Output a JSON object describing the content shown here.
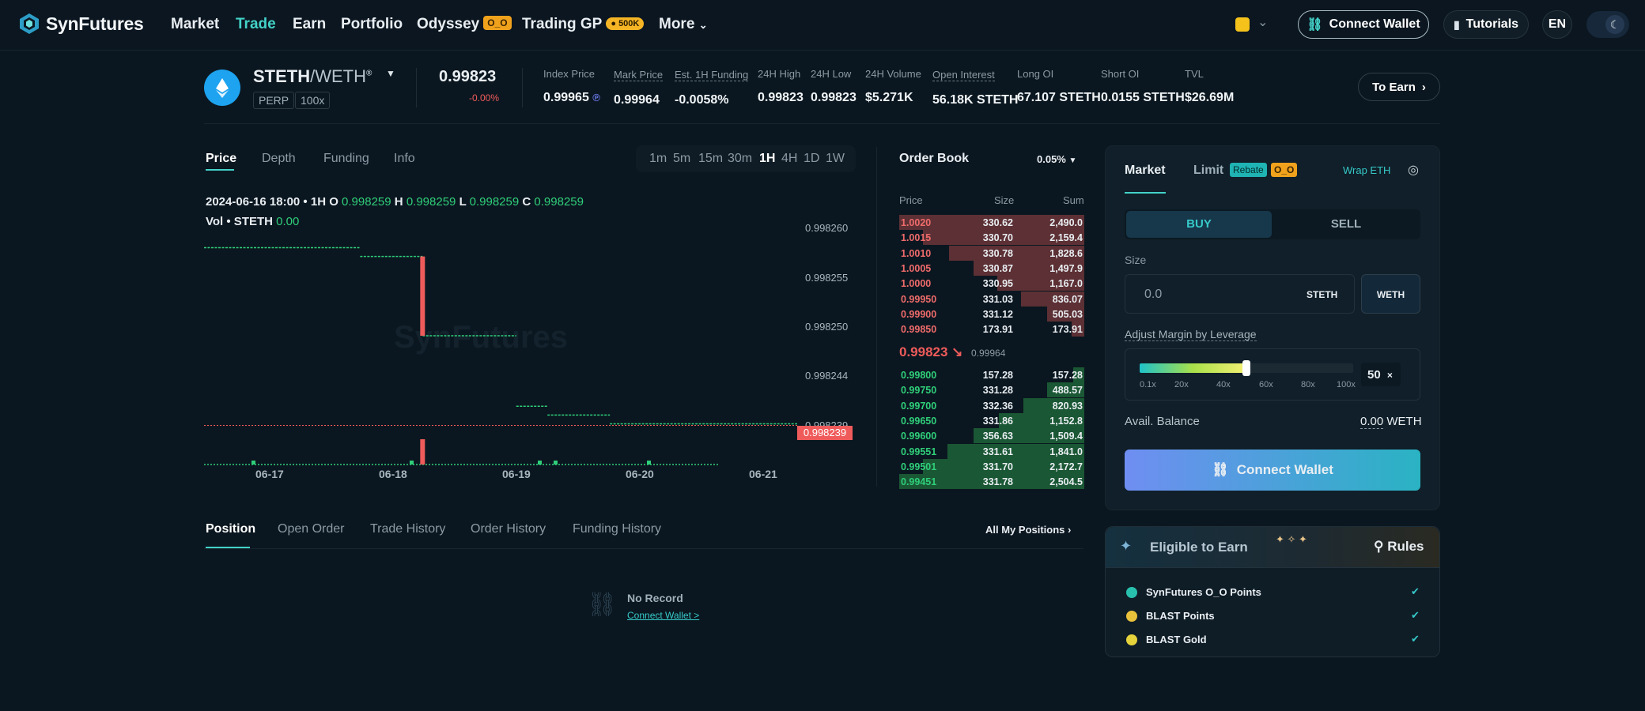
{
  "nav": {
    "brand": "SynFutures",
    "items": [
      "Market",
      "Trade",
      "Earn",
      "Portfolio",
      "Odyssey",
      "Trading GP",
      "More"
    ],
    "odyssey_badge": "O_O",
    "gp_badge": "500K",
    "connect_wallet": "Connect Wallet",
    "tutorials": "Tutorials",
    "lang": "EN"
  },
  "market": {
    "base": "STETH",
    "quote": "/WETH",
    "type_tag": "PERP",
    "leverage_tag": "100x",
    "price": "0.99823",
    "change": "-0.00%",
    "stats": [
      {
        "label": "Index Price",
        "value": "0.99965"
      },
      {
        "label": "Mark Price",
        "value": "0.99964"
      },
      {
        "label": "Est. 1H Funding",
        "value": "-0.0058%"
      },
      {
        "label": "24H High",
        "value": "0.99823"
      },
      {
        "label": "24H Low",
        "value": "0.99823"
      },
      {
        "label": "24H Volume",
        "value": "$5.271K"
      },
      {
        "label": "Open Interest",
        "value": "56.18K STETH"
      },
      {
        "label": "Long OI",
        "value": "67.107 STETH"
      },
      {
        "label": "Short OI",
        "value": "0.0155 STETH"
      },
      {
        "label": "TVL",
        "value": "$26.69M"
      }
    ],
    "to_earn": "To Earn"
  },
  "chart": {
    "tabs": [
      "Price",
      "Depth",
      "Funding",
      "Info"
    ],
    "timeframes": [
      "1m",
      "5m",
      "15m",
      "30m",
      "1H",
      "4H",
      "1D",
      "1W"
    ],
    "active_timeframe": "1H",
    "ohlc_date": "2024-06-16 18:00 • 1H",
    "o_label": "O",
    "o": "0.998259",
    "h_label": "H",
    "h": "0.998259",
    "l_label": "L",
    "l": "0.998259",
    "c_label": "C",
    "c": "0.998259",
    "vol_label": "Vol • STETH",
    "vol": "0.00",
    "price_tag": "0.998239"
  },
  "chart_data": {
    "type": "candlestick",
    "title": "",
    "xlabel": "",
    "ylabel": "",
    "x_ticks": [
      "06-17",
      "06-18",
      "06-19",
      "06-20",
      "06-21"
    ],
    "y_ticks": [
      "0.998260",
      "0.998255",
      "0.998250",
      "0.998244",
      "0.998239"
    ],
    "ylim": [
      0.998236,
      0.998262
    ],
    "last_price": 0.998239,
    "segments": [
      {
        "from": "06-16 18:00",
        "to": "06-18 00:00",
        "value": 0.998259
      },
      {
        "from": "06-18 00:00",
        "to": "06-18 12:00",
        "value": 0.998258
      },
      {
        "from": "06-18 12:00",
        "to": "06-19 06:00",
        "value": 0.998249
      },
      {
        "from": "06-19 06:00",
        "to": "06-19 12:00",
        "value": 0.998241
      },
      {
        "from": "06-19 12:00",
        "to": "06-20 00:00",
        "value": 0.99824
      },
      {
        "from": "06-20 00:00",
        "to": "06-21 12:00",
        "value": 0.998239
      }
    ],
    "big_drop": {
      "time": "06-18 12:00",
      "open": 0.998258,
      "close": 0.998249
    }
  },
  "orderbook": {
    "title": "Order Book",
    "precision": "0.05%",
    "headers": [
      "Price",
      "Size",
      "Sum"
    ],
    "asks": [
      {
        "price": "1.0020",
        "size": "330.62",
        "sum": "2,490.0",
        "depth": 1.0
      },
      {
        "price": "1.0015",
        "size": "330.70",
        "sum": "2,159.4",
        "depth": 0.87
      },
      {
        "price": "1.0010",
        "size": "330.78",
        "sum": "1,828.6",
        "depth": 0.73
      },
      {
        "price": "1.0005",
        "size": "330.87",
        "sum": "1,497.9",
        "depth": 0.6
      },
      {
        "price": "1.0000",
        "size": "330.95",
        "sum": "1,167.0",
        "depth": 0.47
      },
      {
        "price": "0.99950",
        "size": "331.03",
        "sum": "836.07",
        "depth": 0.34
      },
      {
        "price": "0.99900",
        "size": "331.12",
        "sum": "505.03",
        "depth": 0.2
      },
      {
        "price": "0.99850",
        "size": "173.91",
        "sum": "173.91",
        "depth": 0.07
      }
    ],
    "last": "0.99823",
    "mark": "0.99964",
    "bids": [
      {
        "price": "0.99800",
        "size": "157.28",
        "sum": "157.28",
        "depth": 0.06
      },
      {
        "price": "0.99750",
        "size": "331.28",
        "sum": "488.57",
        "depth": 0.2
      },
      {
        "price": "0.99700",
        "size": "332.36",
        "sum": "820.93",
        "depth": 0.33
      },
      {
        "price": "0.99650",
        "size": "331.86",
        "sum": "1,152.8",
        "depth": 0.46
      },
      {
        "price": "0.99600",
        "size": "356.63",
        "sum": "1,509.4",
        "depth": 0.6
      },
      {
        "price": "0.99551",
        "size": "331.61",
        "sum": "1,841.0",
        "depth": 0.74
      },
      {
        "price": "0.99501",
        "size": "331.70",
        "sum": "2,172.7",
        "depth": 0.87
      },
      {
        "price": "0.99451",
        "size": "331.78",
        "sum": "2,504.5",
        "depth": 1.0
      }
    ]
  },
  "trade": {
    "tab_market": "Market",
    "tab_limit": "Limit",
    "rebate": "Rebate",
    "oo": "O_O",
    "wrap": "Wrap ETH",
    "buy": "BUY",
    "sell": "SELL",
    "size_label": "Size",
    "size_placeholder": "0.0",
    "size_unit": "STETH",
    "weth": "WETH",
    "margin_label": "Adjust Margin by Leverage",
    "leverage_marks": [
      "0.1x",
      "20x",
      "40x",
      "60x",
      "80x",
      "100x"
    ],
    "leverage_value": "50",
    "leverage_close": "×",
    "leverage_fraction": 0.5,
    "avail_label": "Avail. Balance",
    "avail_value": "0.00",
    "avail_unit": "WETH",
    "connect": "Connect Wallet"
  },
  "earn": {
    "title": "Eligible to Earn",
    "rules": "Rules",
    "items": [
      "SynFutures O_O Points",
      "BLAST Points",
      "BLAST Gold"
    ],
    "check": "✔"
  },
  "positions": {
    "tabs": [
      "Position",
      "Open Order",
      "Trade History",
      "Order History",
      "Funding History"
    ],
    "all": "All My Positions",
    "empty": "No Record",
    "connect": "Connect Wallet >"
  },
  "colors": {
    "accent": "#43d2c8",
    "green": "#2fcf7a",
    "red": "#ef5b5b",
    "bg": "#0b1720"
  }
}
